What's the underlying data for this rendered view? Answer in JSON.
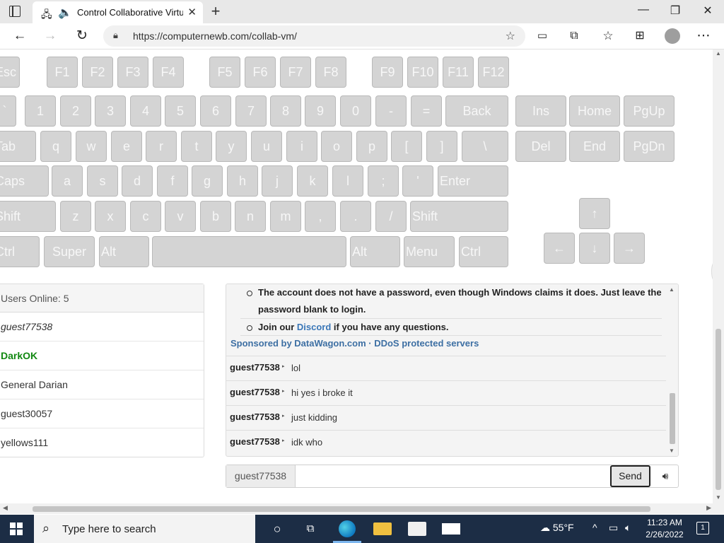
{
  "browser": {
    "tab_title": "Control Collaborative Virtua",
    "tab_close": "✕",
    "new_tab": "+",
    "url": "https://computernewb.com/collab-vm/",
    "window_controls": {
      "minimize": "—",
      "restore": "❐",
      "close": "✕"
    },
    "icons": [
      "tab-actions-icon",
      "favicon-icon",
      "audio-icon",
      "back-icon",
      "forward-icon",
      "refresh-icon",
      "lock-icon",
      "add-favorite-icon",
      "immersive-reader-icon",
      "extensions-icon",
      "favorites-icon",
      "collections-icon",
      "profile-icon",
      "more-icon"
    ]
  },
  "keyboard": {
    "function_row": [
      "Esc",
      "F1",
      "F2",
      "F3",
      "F4",
      "F5",
      "F6",
      "F7",
      "F8",
      "F9",
      "F10",
      "F11",
      "F12"
    ],
    "number_row": [
      "`",
      "1",
      "2",
      "3",
      "4",
      "5",
      "6",
      "7",
      "8",
      "9",
      "0",
      "-",
      "=",
      "Back"
    ],
    "qwerty_row": [
      "Tab",
      "q",
      "w",
      "e",
      "r",
      "t",
      "y",
      "u",
      "i",
      "o",
      "p",
      "[",
      "]",
      "\\"
    ],
    "home_row": [
      "Caps",
      "a",
      "s",
      "d",
      "f",
      "g",
      "h",
      "j",
      "k",
      "l",
      ";",
      "'",
      "Enter"
    ],
    "shift_row": [
      "Shift",
      "z",
      "x",
      "c",
      "v",
      "b",
      "n",
      "m",
      ",",
      ".",
      "/",
      "Shift"
    ],
    "bottom_row": [
      "Ctrl",
      "Super",
      "Alt",
      "",
      "Alt",
      "Menu",
      "Ctrl"
    ],
    "nav_keys": [
      "Ins",
      "Home",
      "PgUp",
      "Del",
      "End",
      "PgDn"
    ],
    "arrows": {
      "up": "↑",
      "left": "←",
      "down": "↓",
      "right": "→"
    }
  },
  "users": {
    "header": "Users Online: 5",
    "list": [
      "guest77538",
      "DarkOK",
      "General Darian",
      "guest30057",
      "yellows111"
    ]
  },
  "chat": {
    "notice_1": "The account does not have a password, even though Windows claims it does. Just leave the password blank to login.",
    "notice_2_prefix": "Join our ",
    "notice_2_link": "Discord",
    "notice_2_suffix": " if you have any questions.",
    "sponsor": "Sponsored by DataWagon.com · DDoS protected servers",
    "messages": [
      {
        "user": "guest77538",
        "text": "lol"
      },
      {
        "user": "guest77538",
        "text": "hi yes i broke it"
      },
      {
        "user": "guest77538",
        "text": "just kidding"
      },
      {
        "user": "guest77538",
        "text": "idk who"
      }
    ],
    "username": "guest77538",
    "input_value": "",
    "send_label": "Send",
    "volume_icon": "speaker-icon"
  },
  "taskbar": {
    "search_placeholder": "Type here to search",
    "weather": "55°F",
    "time": "11:23 AM",
    "date": "2/26/2022",
    "notifications": "1"
  }
}
